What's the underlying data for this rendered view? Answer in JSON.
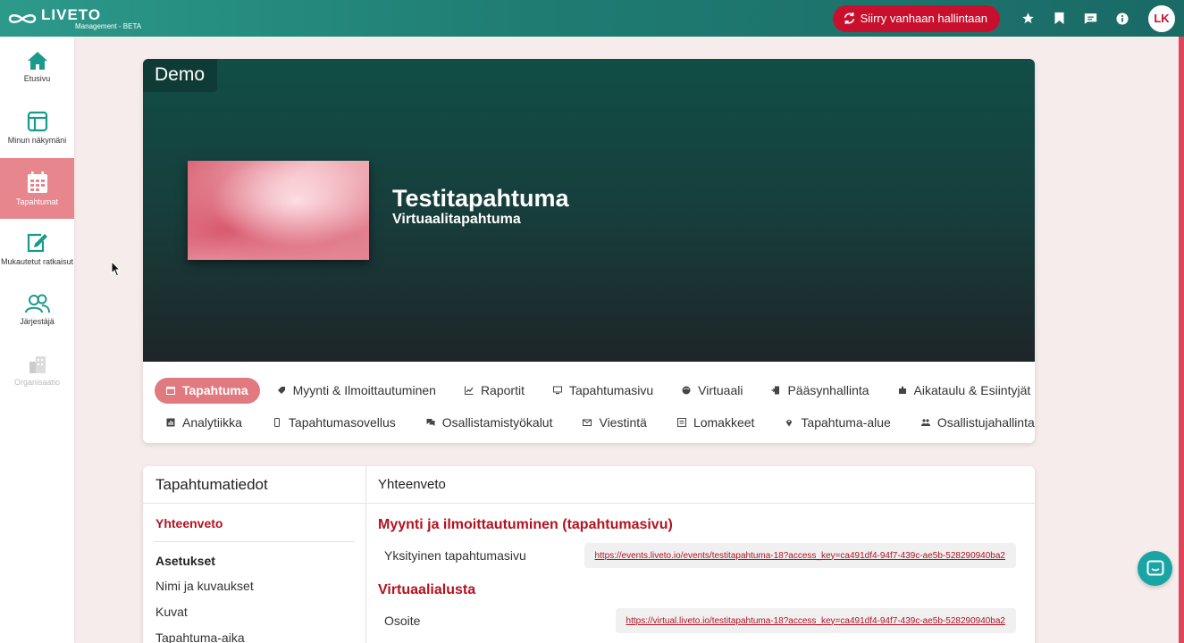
{
  "brand": {
    "name": "LIVETO",
    "subtitle": "Management - BETA"
  },
  "topbar": {
    "legacy_button": "Siirry vanhaan hallintaan",
    "icons": [
      "star-icon",
      "bookmark-icon",
      "message-icon",
      "info-icon"
    ],
    "avatar_initials": "LK"
  },
  "sidebar": {
    "items": [
      {
        "label": "Etusivu",
        "icon": "home-icon"
      },
      {
        "label": "Minun näkymäni",
        "icon": "layout-icon"
      },
      {
        "label": "Tapahtumat",
        "icon": "calendar-icon",
        "active": true
      },
      {
        "label": "Mukautetut ratkaisut",
        "icon": "edit-icon"
      },
      {
        "label": "Järjestäjä",
        "icon": "users-icon"
      },
      {
        "label": "Organisaatio",
        "icon": "building-icon",
        "disabled": true
      }
    ]
  },
  "banner": {
    "tag": "Demo",
    "title": "Testitapahtuma",
    "subtitle": "Virtuaalitapahtuma"
  },
  "nav": {
    "row1": [
      {
        "label": "Tapahtuma",
        "icon": "calendar-icon",
        "active": true
      },
      {
        "label": "Myynti & Ilmoittautuminen",
        "icon": "tag-icon"
      },
      {
        "label": "Raportit",
        "icon": "chart-icon"
      },
      {
        "label": "Tapahtumasivu",
        "icon": "monitor-icon"
      },
      {
        "label": "Virtuaali",
        "icon": "globe-icon"
      },
      {
        "label": "Pääsynhallinta",
        "icon": "door-icon"
      },
      {
        "label": "Aikataulu & Esiintyjät",
        "icon": "puzzle-icon"
      }
    ],
    "row2": [
      {
        "label": "Analytiikka",
        "icon": "analytics-icon"
      },
      {
        "label": "Tapahtumasovellus",
        "icon": "phone-icon"
      },
      {
        "label": "Osallistamistyökalut",
        "icon": "chat-icon"
      },
      {
        "label": "Viestintä",
        "icon": "mail-icon"
      },
      {
        "label": "Lomakkeet",
        "icon": "form-icon"
      },
      {
        "label": "Tapahtuma-alue",
        "icon": "pin-icon"
      },
      {
        "label": "Osallistujahallinta",
        "icon": "people-icon"
      }
    ]
  },
  "details": {
    "left_title": "Tapahtumatiedot",
    "active_item": "Yhteenveto",
    "group_title": "Asetukset",
    "links": [
      "Nimi ja kuvaukset",
      "Kuvat",
      "Tapahtuma-aika"
    ],
    "right_title": "Yhteenveto",
    "sections": [
      {
        "title": "Myynti ja ilmoittautuminen (tapahtumasivu)",
        "label": "Yksityinen tapahtumasivu",
        "url": "https://events.liveto.io/events/testitapahtuma-18?access_key=ca491df4-94f7-439c-ae5b-528290940ba2"
      },
      {
        "title": "Virtuaalialusta",
        "label": "Osoite",
        "url": "https://virtual.liveto.io/testitapahtuma-18?access_key=ca491df4-94f7-439c-ae5b-528290940ba2"
      }
    ]
  },
  "colors": {
    "accent_red": "#c8102e",
    "active_pink": "#e07a80",
    "teal_dark": "#114e46",
    "chat_teal": "#1aa5a5"
  }
}
